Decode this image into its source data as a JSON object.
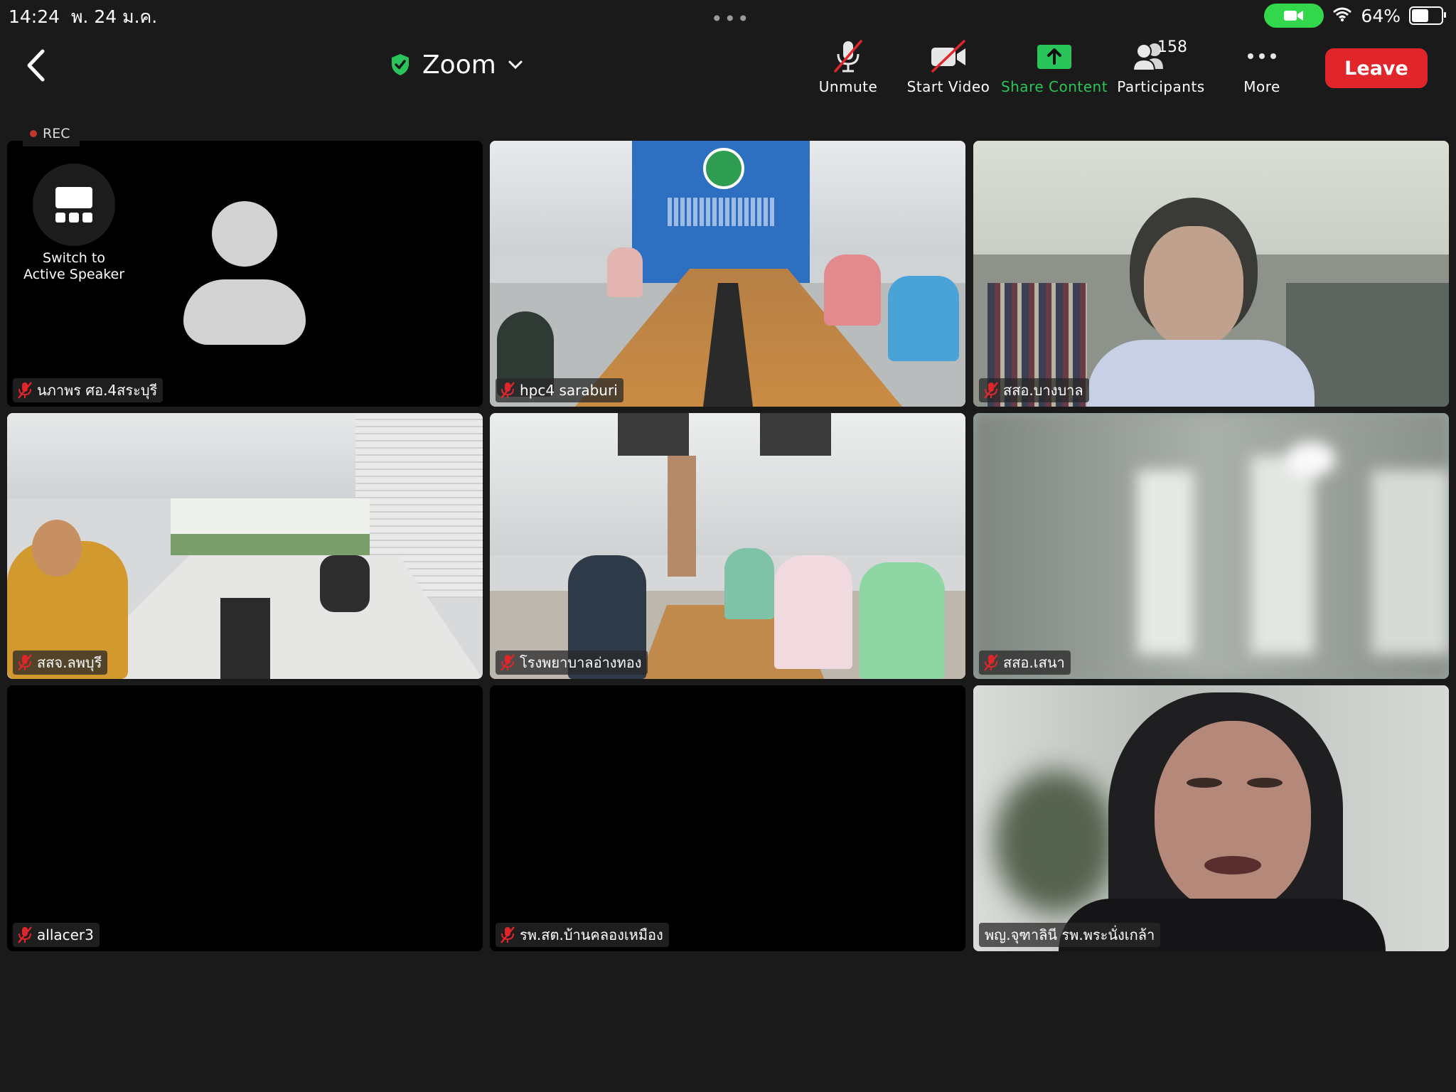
{
  "status_bar": {
    "time": "14:24",
    "date": "พ. 24 ม.ค.",
    "battery_percent": "64%",
    "battery_level": 0.64
  },
  "toolbar": {
    "title": "Zoom",
    "unmute_label": "Unmute",
    "start_video_label": "Start Video",
    "share_content_label": "Share Content",
    "participants_label": "Participants",
    "participants_count": "158",
    "more_label": "More",
    "leave_label": "Leave"
  },
  "recording": {
    "label": "REC"
  },
  "switch_view": {
    "label_line1": "Switch to",
    "label_line2": "Active Speaker"
  },
  "tiles": [
    {
      "name": "นภาพร ศอ.4สระบุรี",
      "muted": true
    },
    {
      "name": "hpc4 saraburi",
      "muted": true
    },
    {
      "name": "สสอ.บางบาล",
      "muted": true
    },
    {
      "name": "สสจ.ลพบุรี",
      "muted": true
    },
    {
      "name": "โรงพยาบาลอ่างทอง",
      "muted": true
    },
    {
      "name": "สสอ.เสนา",
      "muted": true
    },
    {
      "name": "allacer3",
      "muted": true
    },
    {
      "name": "รพ.สต.บ้านคลองเหมือง",
      "muted": true
    },
    {
      "name": "พญ.จุฑาลินี รพ.พระนั่งเกล้า",
      "muted": false,
      "active_speaker": true
    }
  ],
  "colors": {
    "background": "#1a1a1a",
    "accent_green": "#29c55a",
    "leave_red": "#e0262a",
    "muted_red": "#e0262a"
  },
  "icons": [
    "back-chevron-icon",
    "shield-check-icon",
    "chevron-down-icon",
    "mic-off-icon",
    "video-off-icon",
    "share-arrow-icon",
    "participants-icon",
    "more-dots-icon",
    "grid-icon",
    "wifi-icon",
    "camera-icon",
    "battery-icon"
  ]
}
